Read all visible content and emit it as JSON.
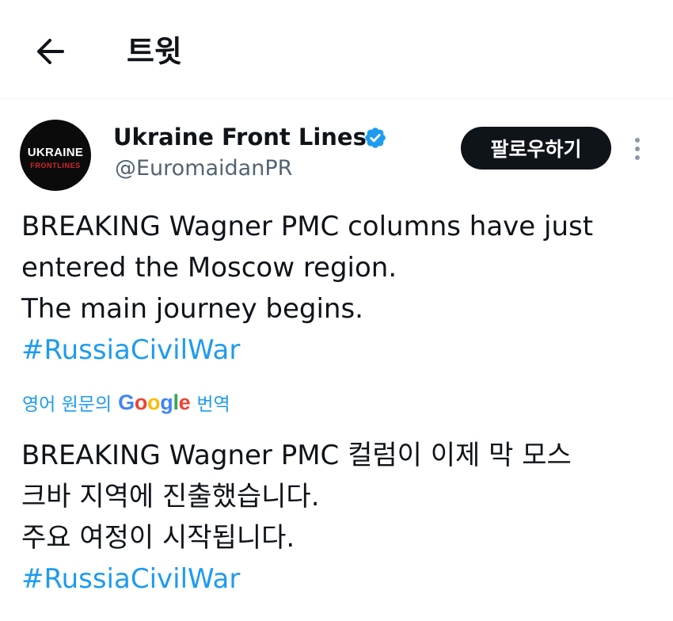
{
  "header": {
    "title": "트윗",
    "back_icon": "arrow-left-icon"
  },
  "author": {
    "avatar_line1": "UKRAINE",
    "avatar_line2": "FRONTLINES",
    "display_name": "Ukraine Front Lines",
    "handle": "@EuromaidanPR",
    "verified": true,
    "verified_color": "#1d9bf0"
  },
  "actions": {
    "follow_label": "팔로우하기",
    "more_icon": "more-vertical-icon"
  },
  "tweet": {
    "lines": [
      "BREAKING Wagner PMC columns have just",
      "entered the Moscow region.",
      "The main journey begins."
    ],
    "hashtag": "#RussiaCivilWar"
  },
  "translation": {
    "prefix": "영어 원문의",
    "provider_letters": [
      "G",
      "o",
      "o",
      "g",
      "l",
      "e"
    ],
    "suffix": "번역",
    "lines": [
      "BREAKING Wagner PMC 컬럼이 이제 막 모스",
      "크바 지역에 진출했습니다.",
      "주요 여정이 시작됩니다."
    ],
    "hashtag": "#RussiaCivilWar"
  },
  "colors": {
    "link": "#1d9bf0",
    "text": "#0f1419",
    "secondary": "#536471",
    "follow_bg": "#0f1419"
  }
}
